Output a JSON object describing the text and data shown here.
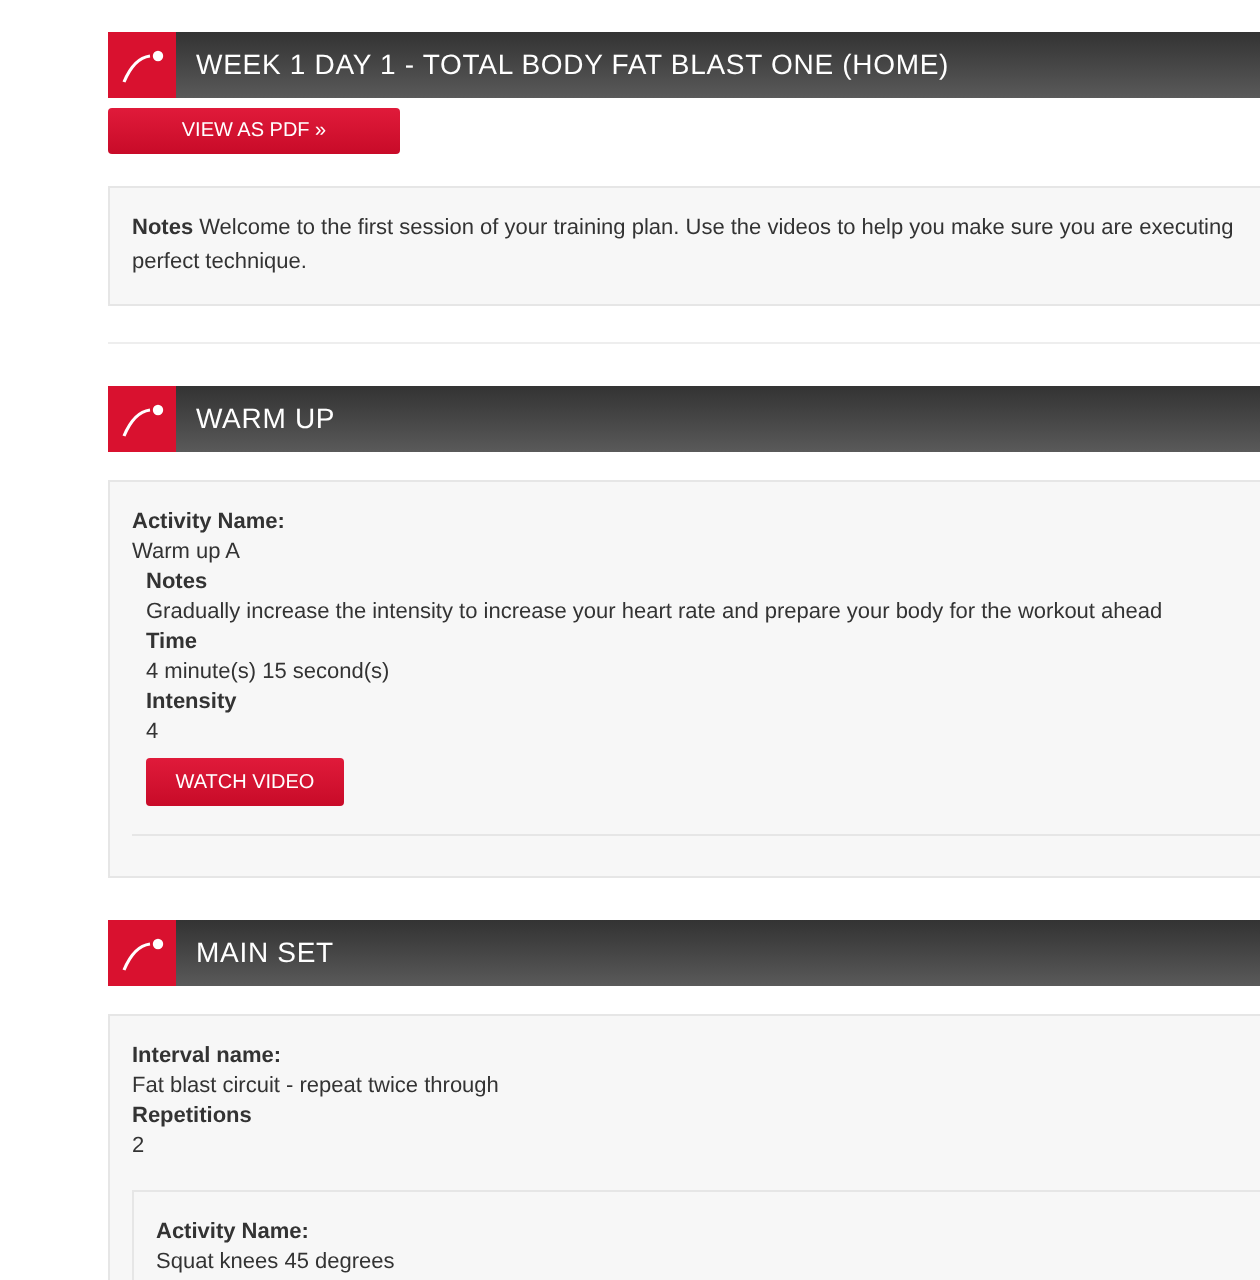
{
  "title": "WEEK 1 DAY 1 - TOTAL BODY FAT BLAST ONE (HOME)",
  "pdf_button": "VIEW AS PDF »",
  "notes": {
    "label": "Notes",
    "text": "Welcome to the first session of your training plan. Use the videos to help you make sure you are executing perfect technique."
  },
  "sections": [
    {
      "title": "WARM UP",
      "kind": "activity",
      "name_label": "Activity Name:",
      "name": "Warm up A",
      "fields": [
        {
          "label": "Notes",
          "value": "Gradually increase the intensity to increase your heart rate and prepare your body for the workout ahead"
        },
        {
          "label": "Time",
          "value": "4 minute(s) 15 second(s)"
        },
        {
          "label": "Intensity",
          "value": "4"
        }
      ],
      "button": "WATCH VIDEO"
    },
    {
      "title": "MAIN SET",
      "kind": "interval",
      "fields": [
        {
          "label": "Interval name:",
          "value": "Fat blast circuit - repeat twice through"
        },
        {
          "label": "Repetitions",
          "value": "2"
        }
      ],
      "activities": [
        {
          "name_label": "Activity Name:",
          "name": "Squat knees 45 degrees"
        }
      ]
    }
  ]
}
